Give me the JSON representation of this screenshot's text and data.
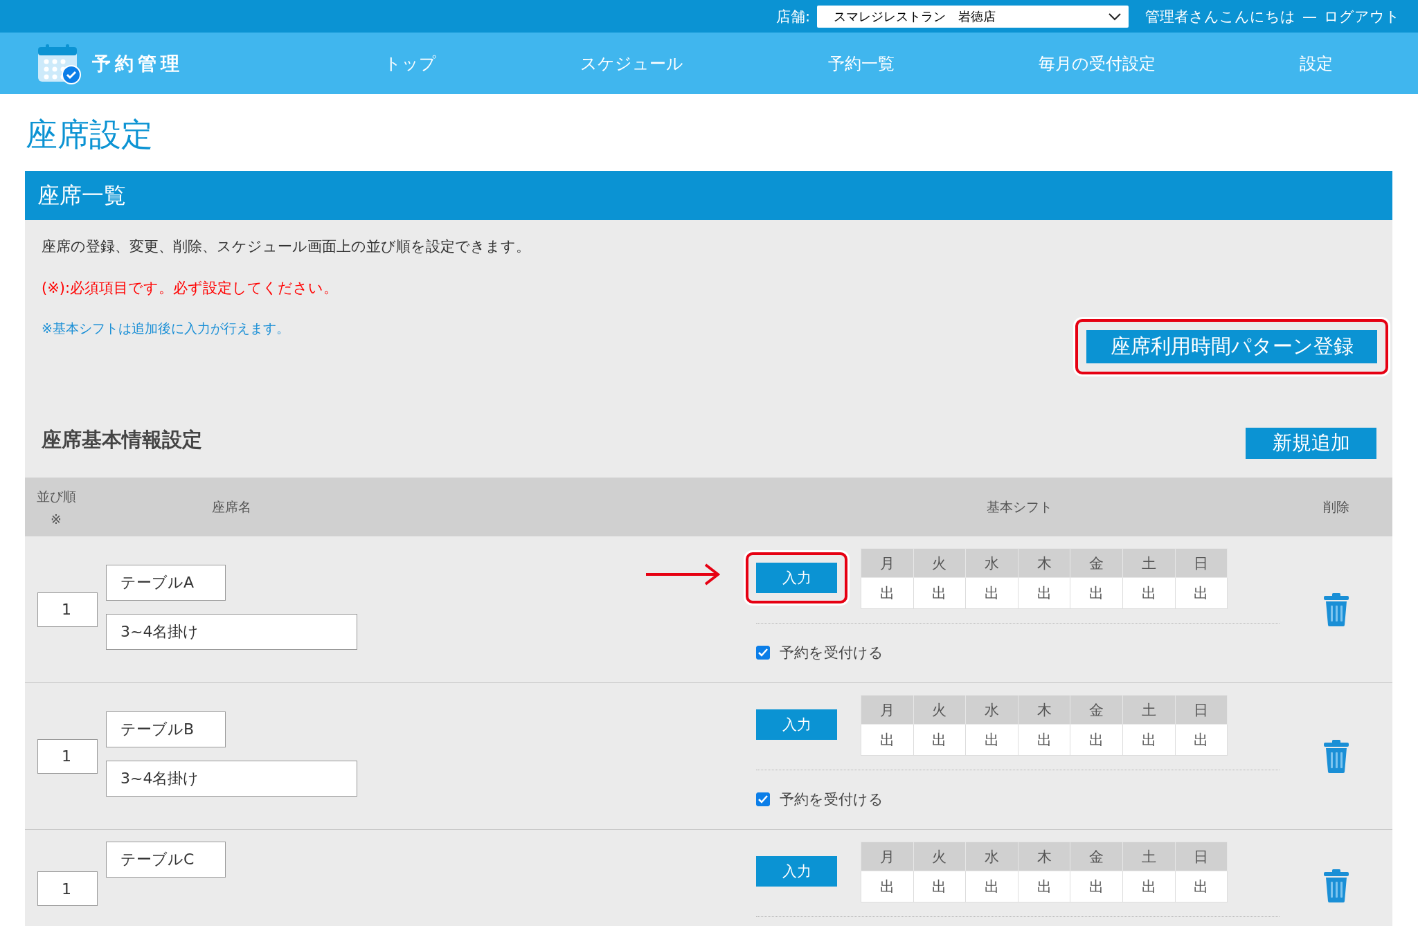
{
  "topbar": {
    "store_label": "店舗:",
    "store_select": "スマレジレストラン　岩徳店",
    "greeting": "管理者さんこんにちは",
    "separator": "—",
    "logout": "ログアウト"
  },
  "nav": {
    "app_title": "予約管理",
    "items": [
      {
        "label": "トップ"
      },
      {
        "label": "スケジュール"
      },
      {
        "label": "予約一覧"
      },
      {
        "label": "毎月の受付設定"
      },
      {
        "label": "設定"
      }
    ]
  },
  "page_title": "座席設定",
  "panel": {
    "title": "座席一覧",
    "description": "座席の登録、変更、削除、スケジュール画面上の並び順を設定できます。",
    "required_note": "(※):必須項目です。必ず設定してください。",
    "shift_note": "※基本シフトは追加後に入力が行えます。",
    "pattern_button": {
      "label": "座席利用時間パターン登録",
      "highlighted": true
    },
    "section_title": "座席基本情報設定",
    "add_button": "新規追加",
    "columns": {
      "order": "並び順",
      "order_mark": "※",
      "name": "座席名",
      "shift": "基本シフト",
      "delete": "削除"
    },
    "rows": [
      {
        "order": "1",
        "name": "テーブルA",
        "capacity": "3~4名掛け",
        "input_button": "入力",
        "highlighted": true,
        "accept_label": "予約を受付ける",
        "accept_checked": true,
        "shift": [
          {
            "day": "月",
            "value": "出"
          },
          {
            "day": "火",
            "value": "出"
          },
          {
            "day": "水",
            "value": "出"
          },
          {
            "day": "木",
            "value": "出"
          },
          {
            "day": "金",
            "value": "出"
          },
          {
            "day": "土",
            "value": "出"
          },
          {
            "day": "日",
            "value": "出"
          }
        ]
      },
      {
        "order": "1",
        "name": "テーブルB",
        "capacity": "3~4名掛け",
        "input_button": "入力",
        "highlighted": false,
        "accept_label": "予約を受付ける",
        "accept_checked": true,
        "shift": [
          {
            "day": "月",
            "value": "出"
          },
          {
            "day": "火",
            "value": "出"
          },
          {
            "day": "水",
            "value": "出"
          },
          {
            "day": "木",
            "value": "出"
          },
          {
            "day": "金",
            "value": "出"
          },
          {
            "day": "土",
            "value": "出"
          },
          {
            "day": "日",
            "value": "出"
          }
        ]
      },
      {
        "order": "1",
        "name": "テーブルC",
        "input_button": "入力",
        "highlighted": false,
        "shift": [
          {
            "day": "月",
            "value": "出"
          },
          {
            "day": "火",
            "value": "出"
          },
          {
            "day": "水",
            "value": "出"
          },
          {
            "day": "木",
            "value": "出"
          },
          {
            "day": "金",
            "value": "出"
          },
          {
            "day": "土",
            "value": "出"
          },
          {
            "day": "日",
            "value": "出"
          }
        ]
      }
    ]
  }
}
